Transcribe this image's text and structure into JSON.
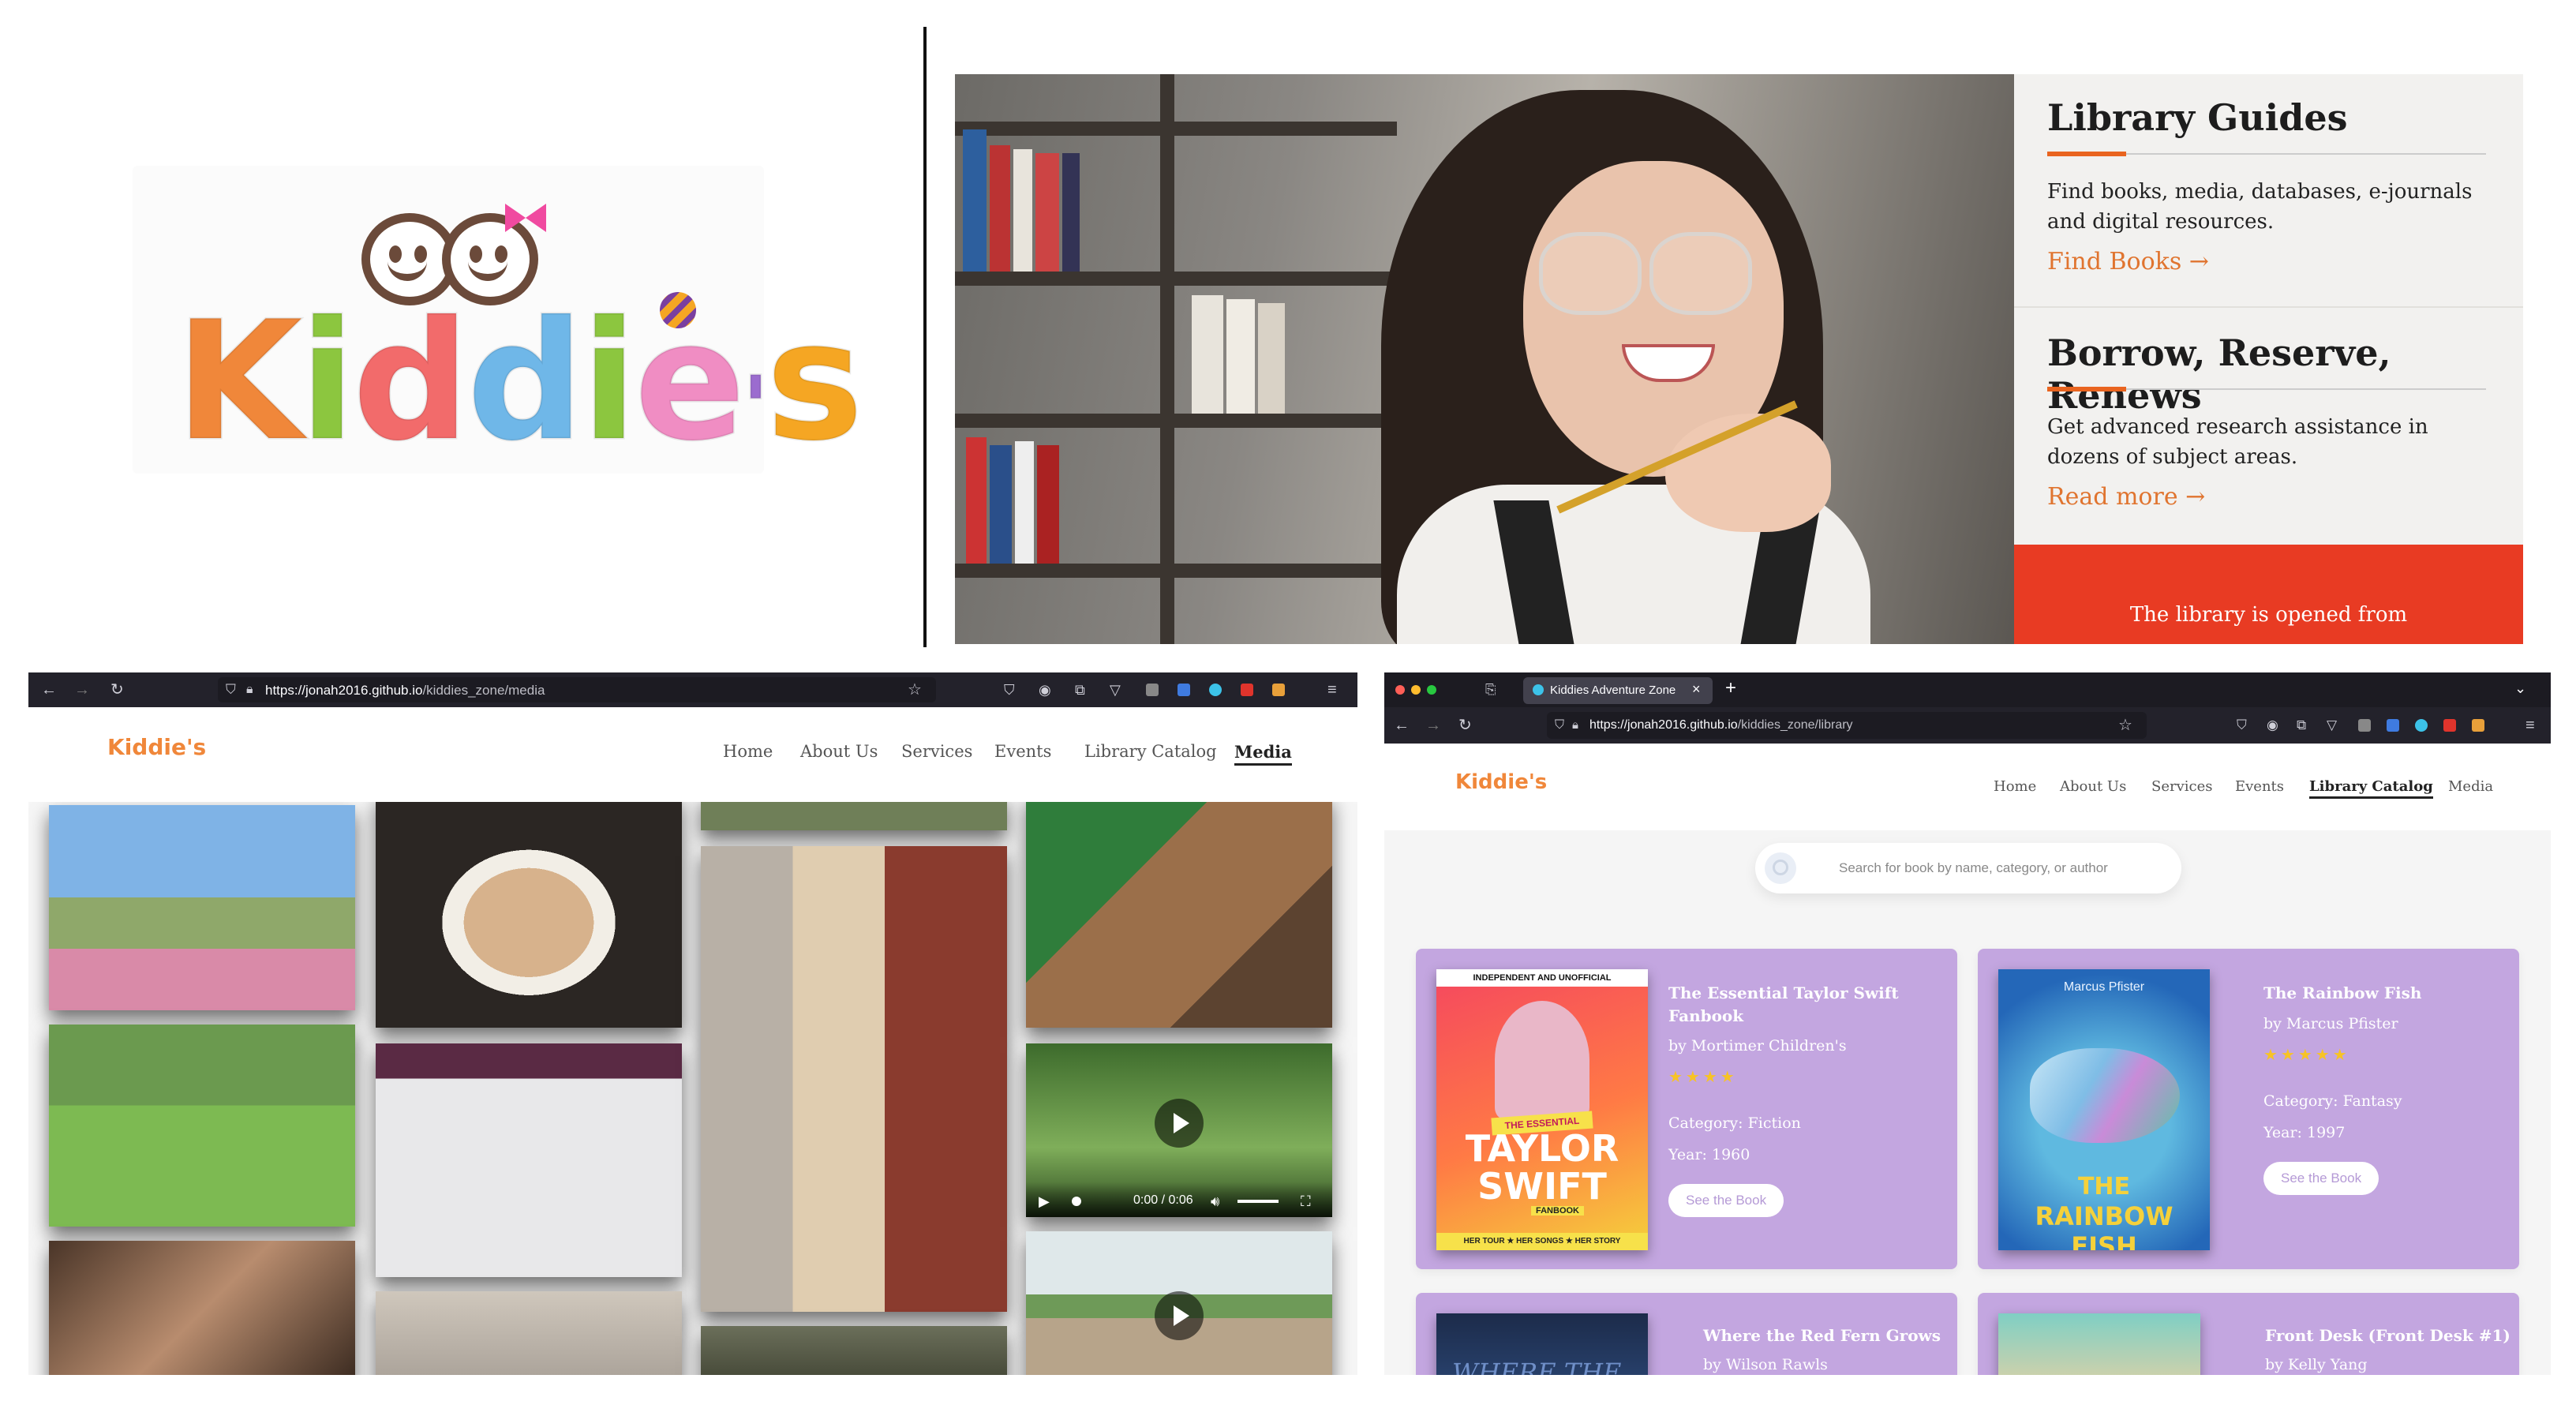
{
  "logo_panel": {
    "brand_text": "Kiddie's",
    "letter_colors": [
      "#f0873a",
      "#8cc63f",
      "#f26b6b",
      "#6fb7e8",
      "#f08dc3",
      "#f5a623",
      "#9b6ccf",
      "#f0873a"
    ]
  },
  "guides": {
    "items": [
      {
        "title": "Library Guides",
        "description": "Find books, media, databases, e-journals and digital resources.",
        "link": "Find Books →"
      },
      {
        "title": "Borrow, Reserve, Renews",
        "description": "Get advanced research assistance in dozens of subject areas.",
        "link": "Read more →"
      }
    ],
    "hours_text": "The library is opened from",
    "accent_color": "#e9641f",
    "hours_color": "#e83b23"
  },
  "media_browser": {
    "url_host": "https://jonah2016.github.io",
    "url_path": "/kiddies_zone/media",
    "logo_text": "Kiddie's",
    "nav": [
      "Home",
      "About Us",
      "Services",
      "Events",
      "Library Catalog",
      "Media"
    ],
    "active_nav": "Media",
    "video_time": "0:00 / 0:06"
  },
  "catalog_browser": {
    "tab_title": "Kiddies Adventure Zone",
    "url_host": "https://jonah2016.github.io",
    "url_path": "/kiddies_zone/library",
    "logo_text": "Kiddie's",
    "nav": [
      "Home",
      "About Us",
      "Services",
      "Events",
      "Library Catalog",
      "Media"
    ],
    "active_nav": "Library Catalog",
    "search_placeholder": "Search for book by name, category, or author",
    "card_color": "#c3a6e0",
    "books": [
      {
        "title_line1": "The Essential Taylor Swift",
        "title_line2": "Fanbook",
        "author": "by Mortimer Children's",
        "rating": "★★★★",
        "category": "Category: Fiction",
        "year": "Year: 1960",
        "button": "See the Book",
        "cover_banner": "INDEPENDENT AND UNOFFICIAL",
        "cover_tag": "THE ESSENTIAL",
        "cover_title1": "TAYLOR",
        "cover_title2": "SWIFT",
        "cover_sub": "FANBOOK",
        "cover_footer": "HER TOUR ★ HER SONGS ★ HER STORY"
      },
      {
        "title_line1": "The Rainbow Fish",
        "author": "by Marcus Pfister",
        "rating": "★★★★★",
        "category": "Category: Fantasy",
        "year": "Year: 1997",
        "button": "See the Book",
        "cover_author": "Marcus Pfister",
        "cover_title1": "THE",
        "cover_title2": "RAINBOW FISH"
      },
      {
        "title_line1": "Where the Red Fern Grows",
        "author": "by Wilson Rawls",
        "cover_title1": "WHERE THE"
      },
      {
        "title_line1": "Front Desk (Front Desk #1)",
        "author": "by Kelly Yang"
      }
    ]
  }
}
